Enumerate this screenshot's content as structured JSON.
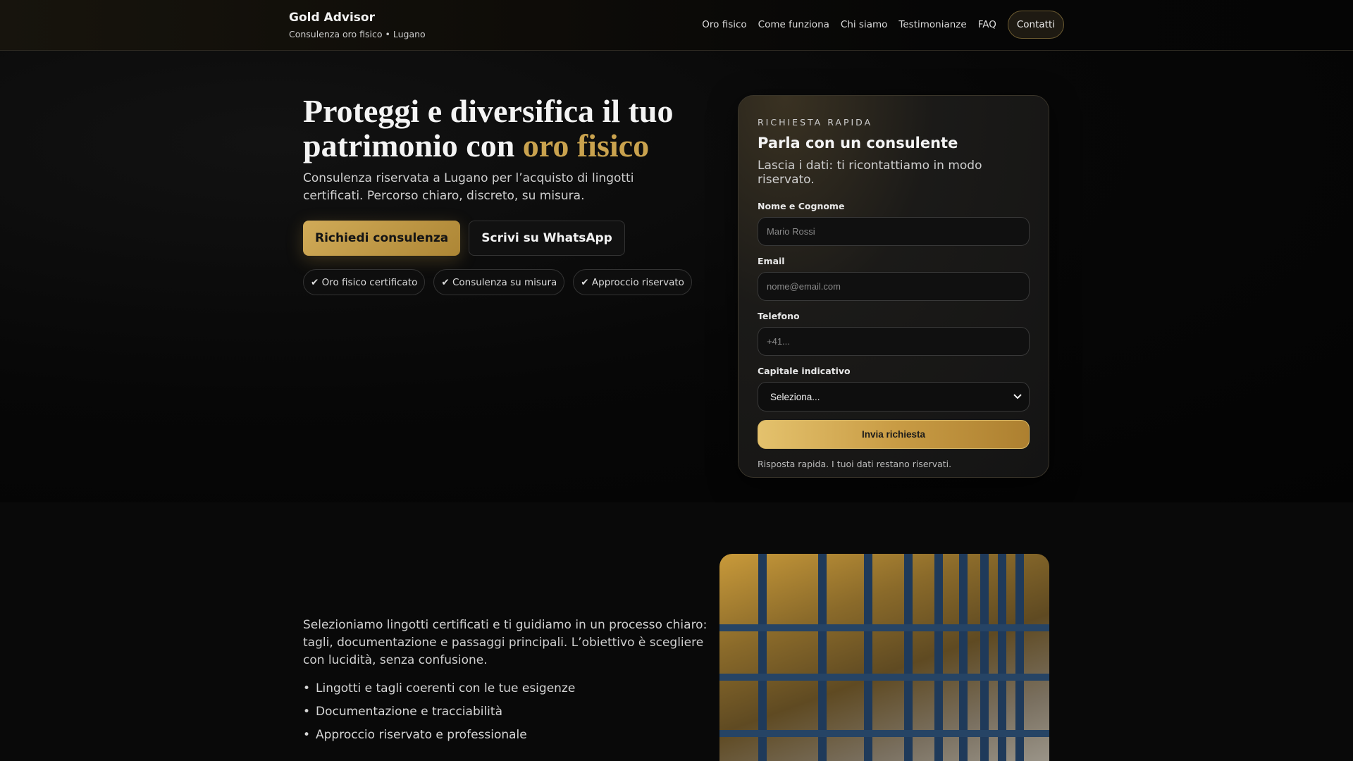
{
  "brand": {
    "name": "Gold Advisor",
    "tagline": "Consulenza oro fisico • Lugano"
  },
  "nav": {
    "items": [
      "Oro fisico",
      "Come funziona",
      "Chi siamo",
      "Testimonianze",
      "FAQ"
    ],
    "cta": "Contatti"
  },
  "hero": {
    "title_pre": "Proteggi e diversifica il tuo patrimonio con ",
    "title_highlight": "oro fisico",
    "lead": "Consulenza riservata a Lugano per l’acquisto di lingotti certificati. Percorso chiaro, discreto, su misura.",
    "primary_button": "Richiedi consulenza",
    "secondary_button": "Scrivi su WhatsApp",
    "chips": [
      "✔ Oro fisico certificato",
      "✔ Consulenza su misura",
      "✔ Approccio riservato"
    ]
  },
  "form": {
    "kicker": "RICHIESTA RAPIDA",
    "title": "Parla con un consulente",
    "subtitle": "Lascia i dati: ti ricontattiamo in modo riservato.",
    "name_label": "Nome e Cognome",
    "name_placeholder": "Mario Rossi",
    "email_label": "Email",
    "email_placeholder": "nome@email.com",
    "phone_label": "Telefono",
    "phone_placeholder": "+41...",
    "capital_label": "Capitale indicativo",
    "capital_value": "Seleziona...",
    "submit": "Invia richiesta",
    "note": "Risposta rapida. I tuoi dati restano riservati."
  },
  "about": {
    "text": "Selezioniamo lingotti certificati e ti guidiamo in un processo chiaro: tagli, documentazione e passaggi principali. L’obiettivo è scegliere con lucidità, senza confusione.",
    "bullets": [
      "Lingotti e tagli coerenti con le tue esigenze",
      "Documentazione e tracciabilità",
      "Approccio riservato e professionale"
    ]
  },
  "colors": {
    "gold": "#c9a24e",
    "background": "#050505"
  }
}
